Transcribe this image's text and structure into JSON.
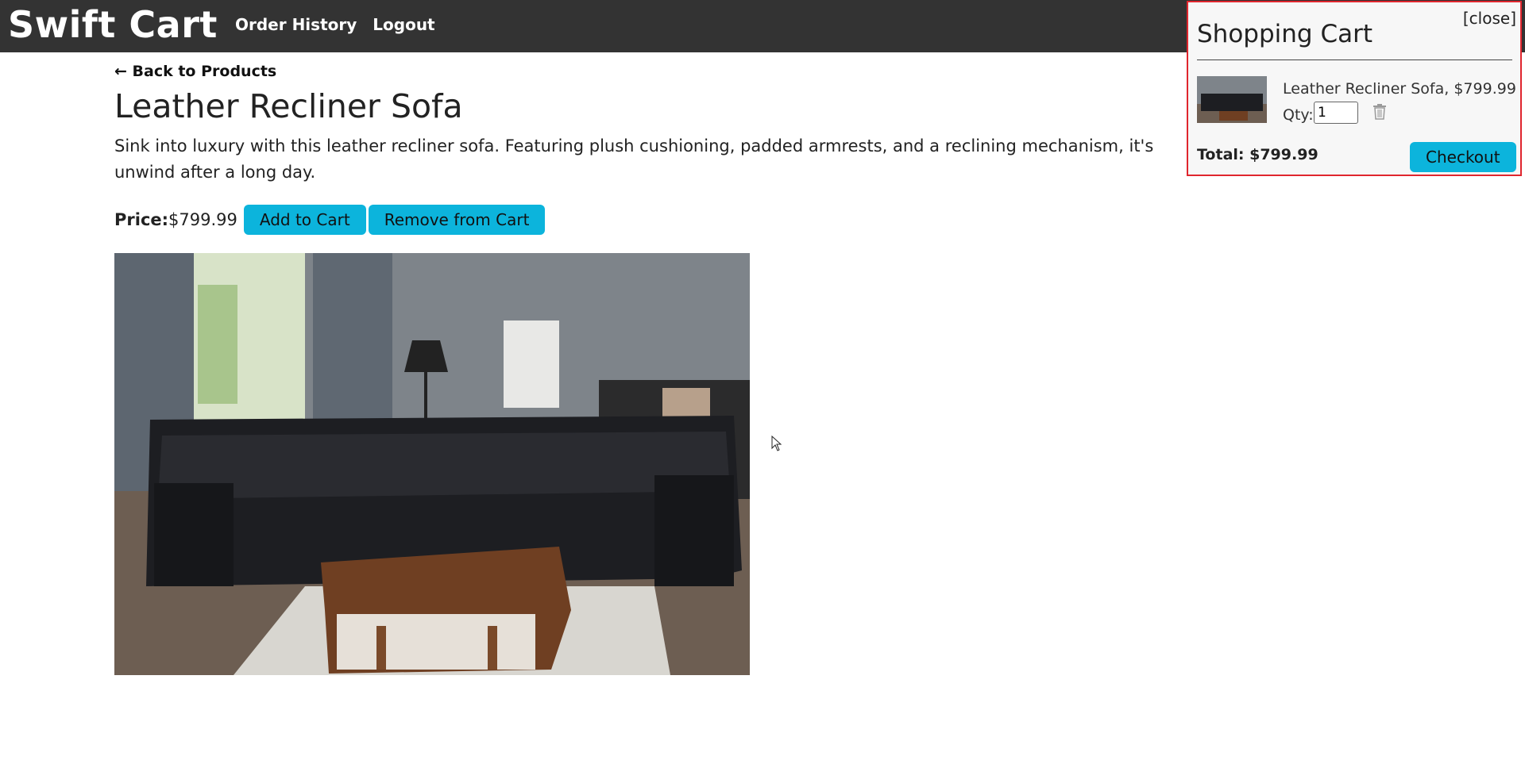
{
  "header": {
    "brand": "Swift Cart",
    "nav": [
      {
        "label": "Order History"
      },
      {
        "label": "Logout"
      }
    ]
  },
  "product": {
    "back_label": "← Back to Products",
    "title": "Leather Recliner Sofa",
    "description": "Sink into luxury with this leather recliner sofa. Featuring plush cushioning, padded armrests, and a reclining mechanism, it's unwind after a long day.",
    "price_label": "Price:",
    "price_value": "$799.99",
    "add_label": "Add to Cart",
    "remove_label": "Remove from Cart"
  },
  "cart": {
    "close_label": "[close]",
    "title": "Shopping Cart",
    "item_name": "Leather Recliner Sofa, $799.99",
    "qty_label": "Qty:",
    "qty_value": "1",
    "total": "Total: $799.99",
    "checkout_label": "Checkout"
  },
  "colors": {
    "header_bg": "#333333",
    "accent": "#0cb4dc",
    "cart_border": "#e0262e"
  },
  "icons": {
    "trash": "trash-icon",
    "cursor": "mouse-cursor-icon"
  }
}
